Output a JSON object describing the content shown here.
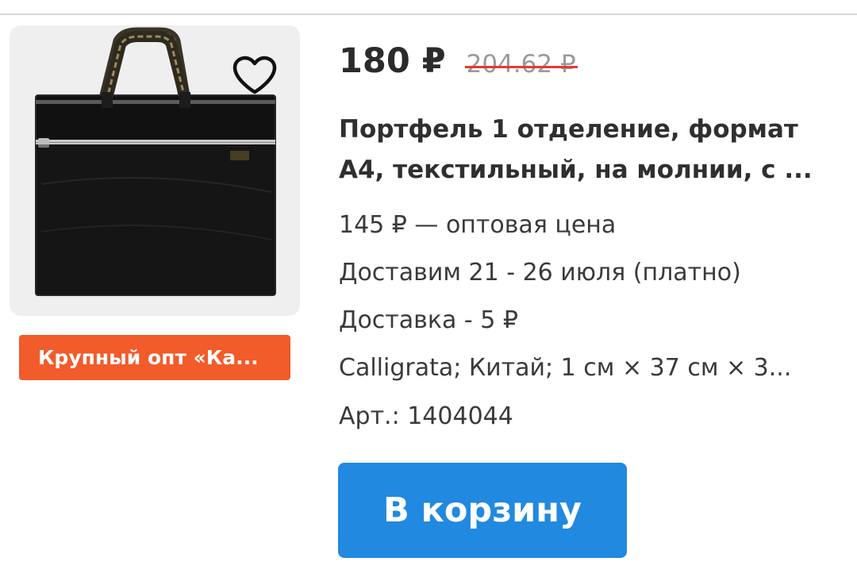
{
  "product": {
    "price": "180 ₽",
    "old_price": "204.62 ₽",
    "title_line_1": "Портфель 1 отделение, формат",
    "title_line_2": "А4, текстильный, на молнии, с ...",
    "wholesale": "145 ₽ — оптовая цена",
    "delivery_dates": "Доставим 21 - 26 июля (платно)",
    "delivery_cost": "Доставка - 5 ₽",
    "specs": "Calligrata; Китай; 1 см × 37 см × 3...",
    "article": "Арт.: 1404044"
  },
  "badge": {
    "label": "Крупный опт «Ка..."
  },
  "actions": {
    "add_to_cart": "В корзину",
    "favorite_icon": "heart-outline-icon"
  },
  "colors": {
    "accent_blue": "#2189e0",
    "badge_orange": "#f25b2a",
    "strike_red": "#e53935"
  }
}
